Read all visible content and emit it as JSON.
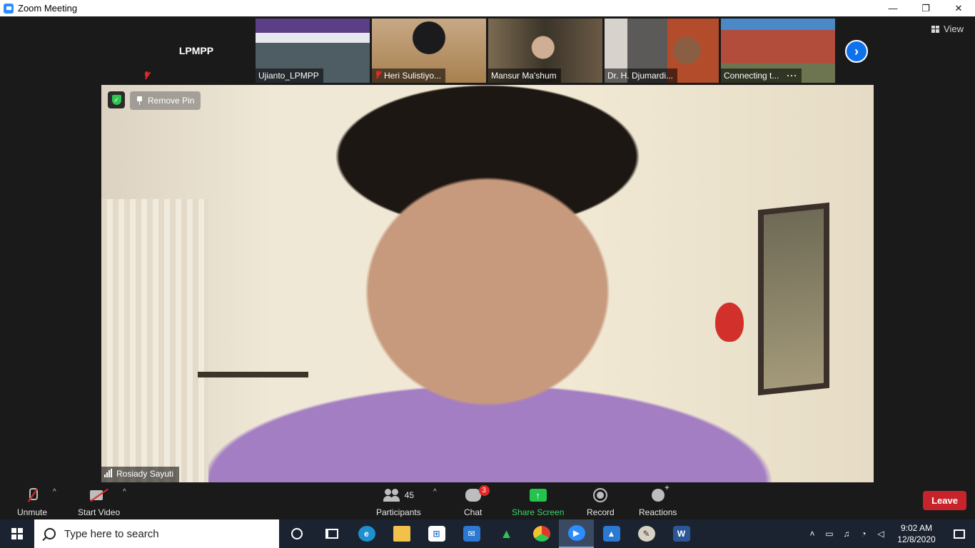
{
  "window": {
    "title": "Zoom Meeting",
    "controls": [
      "—",
      "❐",
      "✕"
    ]
  },
  "gallery": {
    "first_tile_name": "LPMPP",
    "participants": [
      {
        "name": "Ujianto_LPMPP",
        "muted": false
      },
      {
        "name": "Heri Sulistiyo...",
        "muted": true
      },
      {
        "name": "Mansur Ma'shum",
        "muted": false
      },
      {
        "name": "Dr. H. Djumardi...",
        "muted": false
      },
      {
        "name": "Connecting t...",
        "muted": false
      }
    ],
    "more_dots": "···",
    "next_arrow": "›",
    "view_label": "View"
  },
  "main_video": {
    "remove_pin_label": "Remove Pin",
    "speaker_name": "Rosiady Sayuti"
  },
  "toolbar": {
    "unmute_label": "Unmute",
    "start_video_label": "Start Video",
    "participants_label": "Participants",
    "participants_count": "45",
    "chat_label": "Chat",
    "chat_badge": "3",
    "share_label": "Share Screen",
    "record_label": "Record",
    "reactions_label": "Reactions",
    "leave_label": "Leave",
    "caret": "^"
  },
  "taskbar": {
    "search_placeholder": "Type here to search",
    "apps": [
      "cortana-icon",
      "task-view-icon",
      "edge-icon",
      "file-explorer-icon",
      "store-icon",
      "mail-icon",
      "green-app-icon",
      "chrome-icon",
      "zoom-icon",
      "photos-icon",
      "paint-icon",
      "word-icon"
    ],
    "time": "9:02 AM",
    "date": "12/8/2020"
  },
  "colors": {
    "zoom_blue": "#0e72ed",
    "share_green": "#23c44e",
    "leave_red": "#c7232b",
    "mute_red": "#e02828"
  }
}
